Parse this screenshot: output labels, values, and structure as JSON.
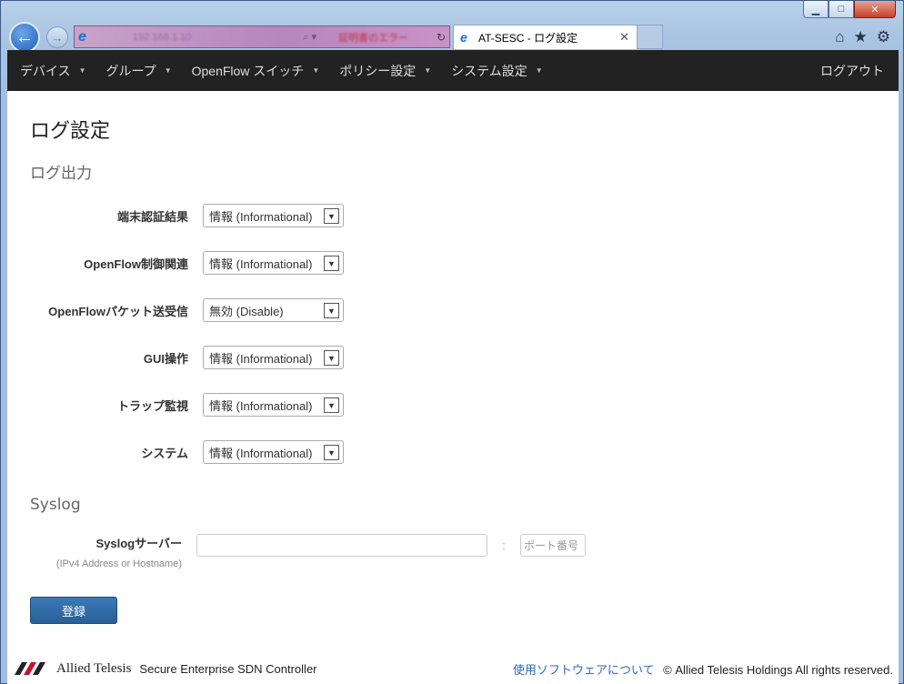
{
  "browser": {
    "address_text": "192.168.1.10",
    "cert_text": "証明書のエラー",
    "tab_title": "AT-SESC - ログ設定"
  },
  "navbar": {
    "items": [
      {
        "label": "デバイス"
      },
      {
        "label": "グループ"
      },
      {
        "label": "OpenFlow スイッチ"
      },
      {
        "label": "ポリシー設定"
      },
      {
        "label": "システム設定"
      }
    ],
    "logout": "ログアウト"
  },
  "page": {
    "title": "ログ設定",
    "section_log": "ログ出力",
    "section_syslog": "Syslog"
  },
  "log_rows": [
    {
      "label": "端末認証結果",
      "value": "情報 (Informational)"
    },
    {
      "label": "OpenFlow制御関連",
      "value": "情報 (Informational)"
    },
    {
      "label": "OpenFlowパケット送受信",
      "value": "無効 (Disable)"
    },
    {
      "label": "GUI操作",
      "value": "情報 (Informational)"
    },
    {
      "label": "トラップ監視",
      "value": "情報 (Informational)"
    },
    {
      "label": "システム",
      "value": "情報 (Informational)"
    }
  ],
  "syslog": {
    "label": "Syslogサーバー",
    "sublabel": "(IPv4 Address or Hostname)",
    "server_value": "",
    "separator": ":",
    "port_placeholder": "ポート番号"
  },
  "submit_label": "登録",
  "footer": {
    "logo": "Allied Telesis",
    "product": "Secure Enterprise SDN Controller",
    "link": "使用ソフトウェアについて",
    "copyright": "© Allied Telesis Holdings All rights reserved."
  }
}
